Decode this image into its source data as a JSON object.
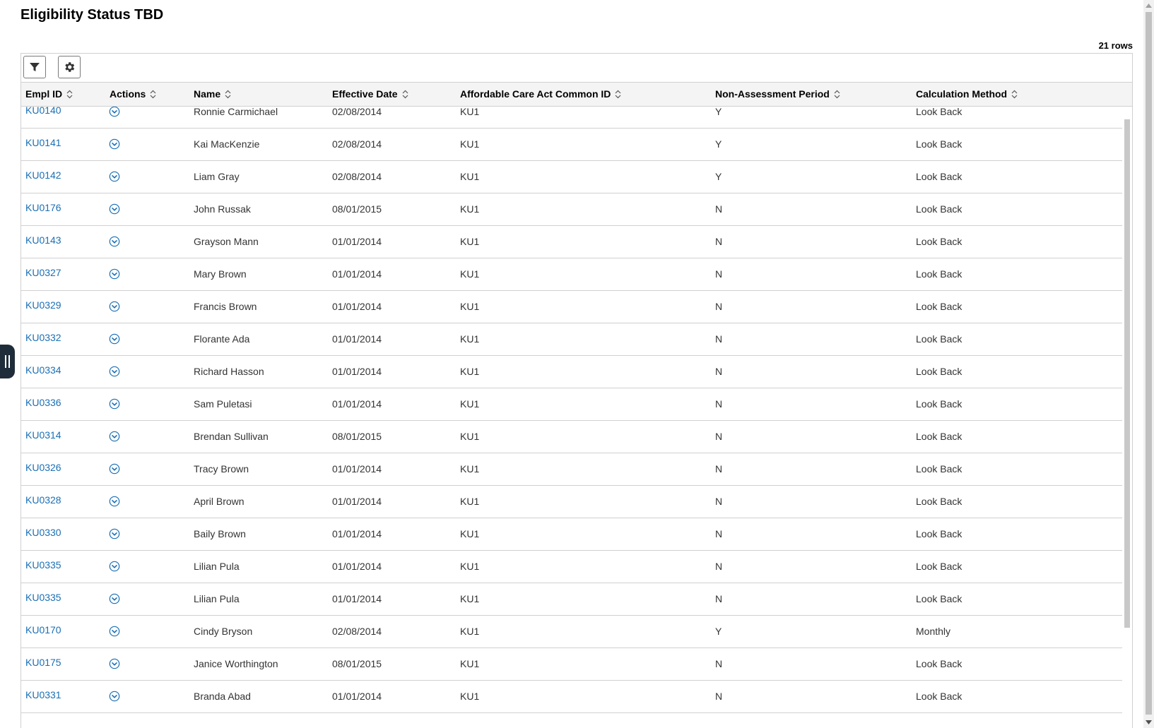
{
  "page": {
    "title": "Eligibility Status TBD",
    "row_count": "21 rows"
  },
  "toolbar": {
    "filter_icon": "filter-icon",
    "settings_icon": "gear-icon"
  },
  "columns": [
    {
      "label": "Empl ID"
    },
    {
      "label": "Actions"
    },
    {
      "label": "Name"
    },
    {
      "label": "Effective Date"
    },
    {
      "label": "Affordable Care Act Common ID"
    },
    {
      "label": "Non-Assessment Period"
    },
    {
      "label": "Calculation Method"
    }
  ],
  "rows": [
    {
      "empl_id": "KU0140",
      "name": "Ronnie Carmichael",
      "date": "02/08/2014",
      "aca": "KU1",
      "nap": "Y",
      "calc": "Look Back"
    },
    {
      "empl_id": "KU0141",
      "name": "Kai MacKenzie",
      "date": "02/08/2014",
      "aca": "KU1",
      "nap": "Y",
      "calc": "Look Back"
    },
    {
      "empl_id": "KU0142",
      "name": "Liam Gray",
      "date": "02/08/2014",
      "aca": "KU1",
      "nap": "Y",
      "calc": "Look Back"
    },
    {
      "empl_id": "KU0176",
      "name": "John Russak",
      "date": "08/01/2015",
      "aca": "KU1",
      "nap": "N",
      "calc": "Look Back"
    },
    {
      "empl_id": "KU0143",
      "name": "Grayson Mann",
      "date": "01/01/2014",
      "aca": "KU1",
      "nap": "N",
      "calc": "Look Back"
    },
    {
      "empl_id": "KU0327",
      "name": "Mary Brown",
      "date": "01/01/2014",
      "aca": "KU1",
      "nap": "N",
      "calc": "Look Back"
    },
    {
      "empl_id": "KU0329",
      "name": "Francis Brown",
      "date": "01/01/2014",
      "aca": "KU1",
      "nap": "N",
      "calc": "Look Back"
    },
    {
      "empl_id": "KU0332",
      "name": "Florante Ada",
      "date": "01/01/2014",
      "aca": "KU1",
      "nap": "N",
      "calc": "Look Back"
    },
    {
      "empl_id": "KU0334",
      "name": "Richard Hasson",
      "date": "01/01/2014",
      "aca": "KU1",
      "nap": "N",
      "calc": "Look Back"
    },
    {
      "empl_id": "KU0336",
      "name": "Sam Puletasi",
      "date": "01/01/2014",
      "aca": "KU1",
      "nap": "N",
      "calc": "Look Back"
    },
    {
      "empl_id": "KU0314",
      "name": "Brendan Sullivan",
      "date": "08/01/2015",
      "aca": "KU1",
      "nap": "N",
      "calc": "Look Back"
    },
    {
      "empl_id": "KU0326",
      "name": "Tracy Brown",
      "date": "01/01/2014",
      "aca": "KU1",
      "nap": "N",
      "calc": "Look Back"
    },
    {
      "empl_id": "KU0328",
      "name": "April Brown",
      "date": "01/01/2014",
      "aca": "KU1",
      "nap": "N",
      "calc": "Look Back"
    },
    {
      "empl_id": "KU0330",
      "name": "Baily Brown",
      "date": "01/01/2014",
      "aca": "KU1",
      "nap": "N",
      "calc": "Look Back"
    },
    {
      "empl_id": "KU0335",
      "name": "Lilian Pula",
      "date": "01/01/2014",
      "aca": "KU1",
      "nap": "N",
      "calc": "Look Back"
    },
    {
      "empl_id": "KU0335",
      "name": "Lilian Pula",
      "date": "01/01/2014",
      "aca": "KU1",
      "nap": "N",
      "calc": "Look Back"
    },
    {
      "empl_id": "KU0170",
      "name": "Cindy Bryson",
      "date": "02/08/2014",
      "aca": "KU1",
      "nap": "Y",
      "calc": "Monthly"
    },
    {
      "empl_id": "KU0175",
      "name": "Janice Worthington",
      "date": "08/01/2015",
      "aca": "KU1",
      "nap": "N",
      "calc": "Look Back"
    },
    {
      "empl_id": "KU0331",
      "name": "Branda Abad",
      "date": "01/01/2014",
      "aca": "KU1",
      "nap": "N",
      "calc": "Look Back"
    }
  ],
  "colors": {
    "link": "#1a6fb5",
    "side_handle": "#1f2d3a",
    "action_icon": "#1a6fb5"
  }
}
